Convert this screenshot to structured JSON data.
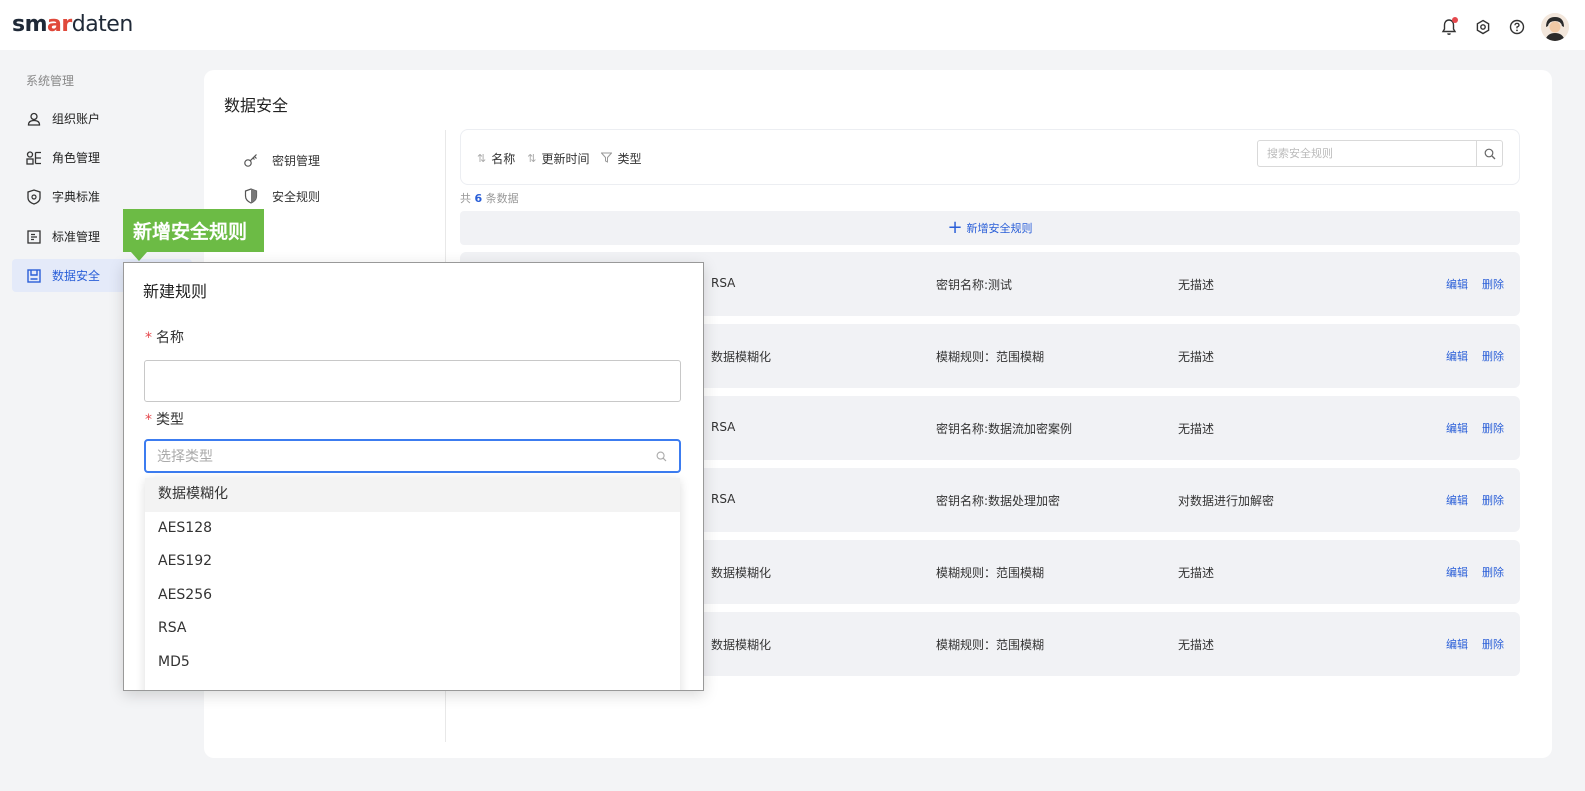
{
  "header": {
    "logo": {
      "part1": "sm",
      "part2": "ar",
      "part3": "daten"
    },
    "notification_badge_color": "#e5484d"
  },
  "sidebar": {
    "group_title": "系统管理",
    "items": [
      {
        "label": "组织账户",
        "icon": "user-icon"
      },
      {
        "label": "角色管理",
        "icon": "roles-icon"
      },
      {
        "label": "字典标准",
        "icon": "dictionary-icon"
      },
      {
        "label": "标准管理",
        "icon": "standard-icon"
      },
      {
        "label": "数据安全",
        "icon": "data-security-icon",
        "active": true
      }
    ]
  },
  "main": {
    "title": "数据安全",
    "submenu": [
      {
        "label": "密钥管理",
        "icon": "key-icon"
      },
      {
        "label": "安全规则",
        "icon": "shield-icon"
      }
    ],
    "toolbar": {
      "sort_name": "名称",
      "sort_updated": "更新时间",
      "filter_type": "类型",
      "search_placeholder": "搜索安全规则"
    },
    "count": {
      "prefix": "共",
      "number": "6",
      "suffix": "条数据"
    },
    "add_rule_label": "新增安全规则",
    "rows": [
      {
        "type": "RSA",
        "rule": "密钥名称:测试",
        "desc": "无描述",
        "edit": "编辑",
        "delete": "删除"
      },
      {
        "type": "数据模糊化",
        "rule": "模糊规则：范围模糊",
        "desc": "无描述",
        "edit": "编辑",
        "delete": "删除"
      },
      {
        "type": "RSA",
        "rule": "密钥名称:数据流加密案例",
        "desc": "无描述",
        "edit": "编辑",
        "delete": "删除"
      },
      {
        "type": "RSA",
        "rule": "密钥名称:数据处理加密",
        "desc": "对数据进行加解密",
        "edit": "编辑",
        "delete": "删除"
      },
      {
        "type": "数据模糊化",
        "rule": "模糊规则：范围模糊",
        "desc": "无描述",
        "edit": "编辑",
        "delete": "删除"
      },
      {
        "type": "数据模糊化",
        "rule": "模糊规则：范围模糊",
        "desc": "无描述",
        "edit": "编辑",
        "delete": "删除"
      }
    ]
  },
  "callout": {
    "label": "新增安全规则",
    "color": "#6cbb45"
  },
  "dialog": {
    "title": "新建规则",
    "name_label": "名称",
    "name_value": "",
    "type_label": "类型",
    "required_mark": "*",
    "type_placeholder": "选择类型",
    "type_options": [
      "数据模糊化",
      "AES128",
      "AES192",
      "AES256",
      "RSA",
      "MD5"
    ]
  },
  "colors": {
    "accent": "#2a5fd8",
    "active_bg": "#e4eaf9",
    "focus_border": "#3c7cf0"
  }
}
